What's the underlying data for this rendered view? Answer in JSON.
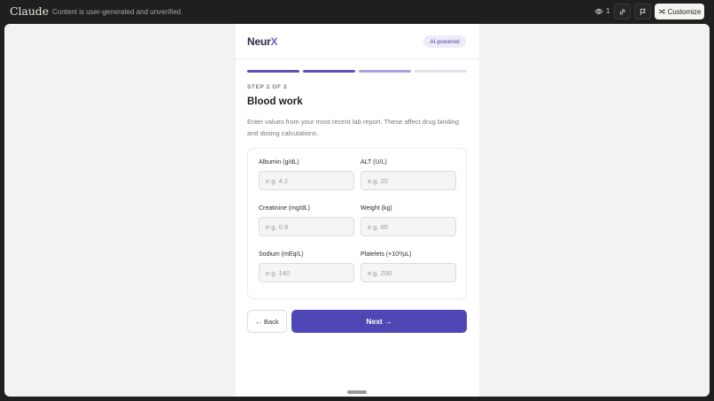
{
  "topbar": {
    "brand": "Claude",
    "disclaimer": "Content is user-generated and unverified.",
    "view_count": "1",
    "customize_label": "Customize",
    "icons": [
      "eye-icon",
      "link-icon",
      "flag-icon",
      "shuffle-icon"
    ]
  },
  "app": {
    "logo_main": "Neur",
    "logo_accent": "X",
    "badge": "AI-powered",
    "progress": {
      "total_steps": 4,
      "completed_steps": 2,
      "upcoming_highlight": 1
    },
    "step_label": "STEP 2 OF 3",
    "title": "Blood work",
    "description": "Enter values from your most recent lab report. These affect drug binding and dosing calculations.",
    "fields": [
      {
        "label": "Albumin (g/dL)",
        "placeholder": "e.g. 4.2",
        "value": ""
      },
      {
        "label": "ALT (U/L)",
        "placeholder": "e.g. 25",
        "value": ""
      },
      {
        "label": "Creatinine (mg/dL)",
        "placeholder": "e.g. 0.9",
        "value": ""
      },
      {
        "label": "Weight (kg)",
        "placeholder": "e.g. 65",
        "value": ""
      },
      {
        "label": "Sodium (mEq/L)",
        "placeholder": "e.g. 140",
        "value": ""
      },
      {
        "label": "Platelets (×10³/µL)",
        "placeholder": "e.g. 250",
        "value": ""
      }
    ],
    "back_label": "← Back",
    "next_label": "Next →"
  },
  "colors": {
    "accent": "#4f47b5",
    "progress_done": "#5a52b8",
    "progress_next": "#a9a4dc",
    "progress_todo": "#e2e0f0"
  }
}
